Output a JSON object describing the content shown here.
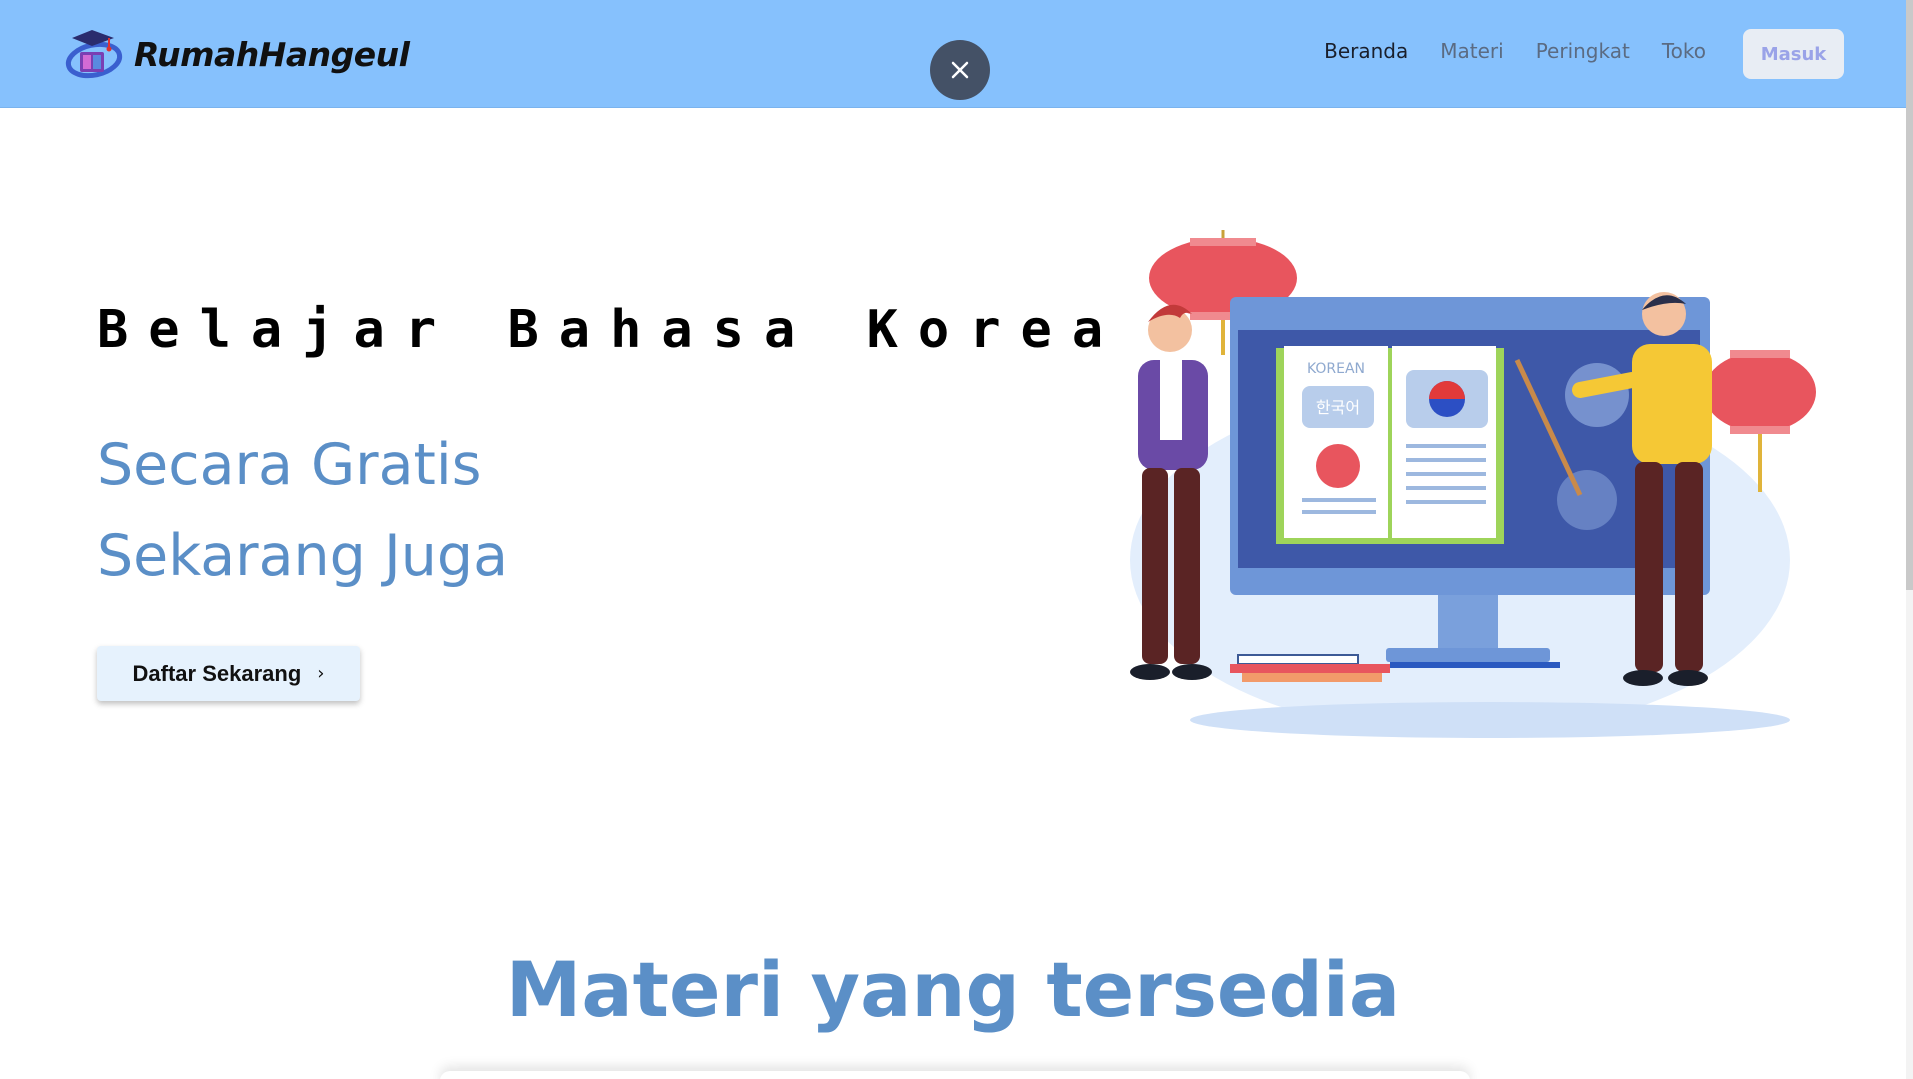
{
  "header": {
    "logo_text": "RumahHangeul",
    "nav": [
      {
        "label": "Beranda",
        "active": true
      },
      {
        "label": "Materi",
        "active": false
      },
      {
        "label": "Peringkat",
        "active": false
      },
      {
        "label": "Toko",
        "active": false
      }
    ],
    "login_label": "Masuk",
    "close_icon": "close-icon",
    "colors": {
      "header_bg": "#86c1fd",
      "accent": "#5b8fc7"
    }
  },
  "hero": {
    "title": "Belajar Bahasa Korea",
    "subtitle_1": "Secara Gratis",
    "subtitle_2": "Sekarang Juga",
    "cta_label": "Daftar Sekarang",
    "cta_icon": "chevron-right-icon",
    "illustration": {
      "book_label": "KOREAN",
      "book_korean": "한국어"
    }
  },
  "section": {
    "title": "Materi yang tersedia"
  }
}
